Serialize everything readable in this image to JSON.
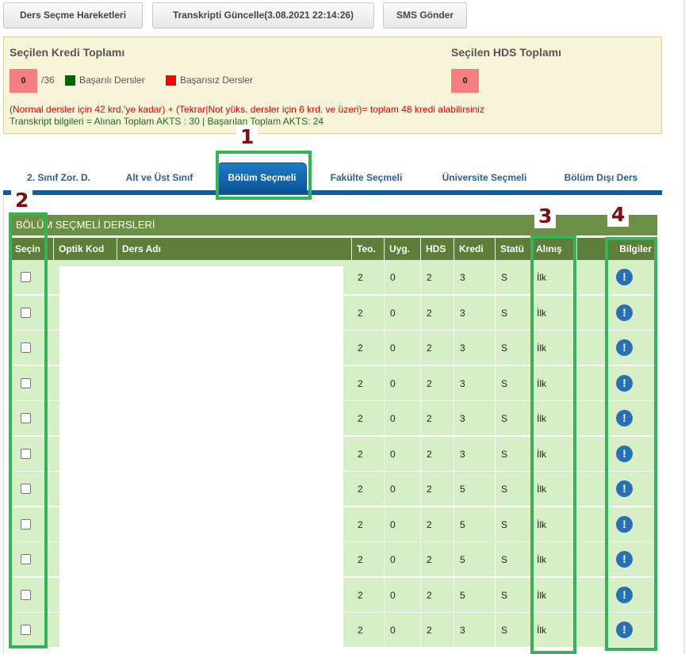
{
  "toolbar": {
    "hareketler": "Ders Seçme Hareketleri",
    "transkript": "Transkripti Güncelle(3.08.2021 22:14:26)",
    "sms": "SMS Gönder"
  },
  "summary": {
    "kredi_title": "Seçilen Kredi Toplamı",
    "kredi_value": "0",
    "kredi_max": "/36",
    "legend_ok": "Başarılı Dersler",
    "legend_fail": "Başarısız Dersler",
    "hds_title": "Seçilen HDS Toplamı",
    "hds_value": "0",
    "info_red": "(Normal dersler için 42 krd.'ye kadar) + (Tekrar|Not yüks. dersler için 6 krd. ve üzeri)= toplam 48 kredi alabilirsiniz",
    "info_green": "Transkript bilgileri = Alınan Toplam AKTS : 30 | Başarılan Toplam AKTS: 24"
  },
  "colors": {
    "success": "#006400",
    "fail": "#ff0000",
    "count_box": "#f47f7f",
    "tab_active": "#0f5c9e",
    "header_green": "#5c7e3a",
    "row_green": "#d6efc6",
    "highlight": "#35b25a",
    "marker": "#7a0f12"
  },
  "tabs": [
    "2. Sınıf Zor. D.",
    "Alt ve Üst Sınıf",
    "Bölüm Seçmeli",
    "Fakülte Seçmeli",
    "Üniversite Seçmeli",
    "Bölüm Dışı Ders"
  ],
  "active_tab": "Bölüm Seçmeli",
  "table": {
    "caption": "BÖLÜM SEÇMELİ DERSLERİ",
    "headers": [
      "Seçin",
      "Optik Kod",
      "Ders Adı",
      "Teo.",
      "Uyg.",
      "HDS",
      "Kredi",
      "Statü",
      "Alınış",
      "Bilgiler"
    ],
    "rows": [
      {
        "teo": "2",
        "uyg": "0",
        "hds": "2",
        "kredi": "3",
        "statu": "S",
        "alinis": "İlk"
      },
      {
        "teo": "2",
        "uyg": "0",
        "hds": "2",
        "kredi": "3",
        "statu": "S",
        "alinis": "İlk"
      },
      {
        "teo": "2",
        "uyg": "0",
        "hds": "2",
        "kredi": "3",
        "statu": "S",
        "alinis": "İlk"
      },
      {
        "teo": "2",
        "uyg": "0",
        "hds": "2",
        "kredi": "3",
        "statu": "S",
        "alinis": "İlk"
      },
      {
        "teo": "2",
        "uyg": "0",
        "hds": "2",
        "kredi": "3",
        "statu": "S",
        "alinis": "İlk"
      },
      {
        "teo": "2",
        "uyg": "0",
        "hds": "2",
        "kredi": "3",
        "statu": "S",
        "alinis": "İlk"
      },
      {
        "teo": "2",
        "uyg": "0",
        "hds": "2",
        "kredi": "5",
        "statu": "S",
        "alinis": "İlk"
      },
      {
        "teo": "2",
        "uyg": "0",
        "hds": "2",
        "kredi": "5",
        "statu": "S",
        "alinis": "İlk"
      },
      {
        "teo": "2",
        "uyg": "0",
        "hds": "2",
        "kredi": "5",
        "statu": "S",
        "alinis": "İlk"
      },
      {
        "teo": "2",
        "uyg": "0",
        "hds": "2",
        "kredi": "5",
        "statu": "S",
        "alinis": "İlk"
      },
      {
        "teo": "2",
        "uyg": "0",
        "hds": "2",
        "kredi": "3",
        "statu": "S",
        "alinis": "İlk"
      }
    ]
  },
  "icons": {
    "info": "info-icon"
  },
  "annotations": [
    "1",
    "2",
    "3",
    "4"
  ]
}
